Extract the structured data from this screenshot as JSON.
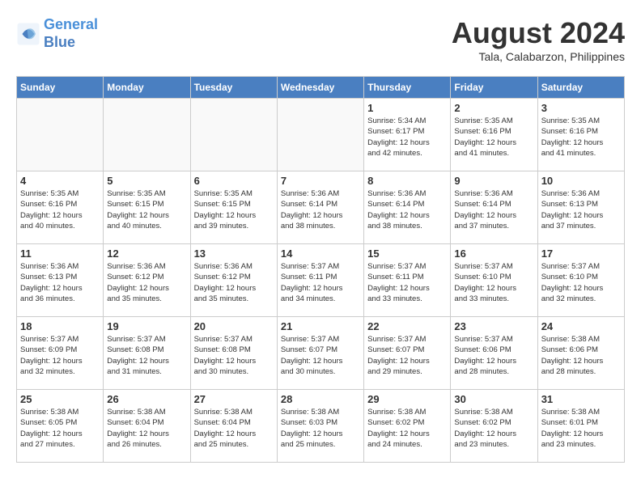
{
  "header": {
    "logo_line1": "General",
    "logo_line2": "Blue",
    "month": "August 2024",
    "location": "Tala, Calabarzon, Philippines"
  },
  "days_of_week": [
    "Sunday",
    "Monday",
    "Tuesday",
    "Wednesday",
    "Thursday",
    "Friday",
    "Saturday"
  ],
  "weeks": [
    [
      {
        "day": "",
        "info": ""
      },
      {
        "day": "",
        "info": ""
      },
      {
        "day": "",
        "info": ""
      },
      {
        "day": "",
        "info": ""
      },
      {
        "day": "1",
        "info": "Sunrise: 5:34 AM\nSunset: 6:17 PM\nDaylight: 12 hours\nand 42 minutes."
      },
      {
        "day": "2",
        "info": "Sunrise: 5:35 AM\nSunset: 6:16 PM\nDaylight: 12 hours\nand 41 minutes."
      },
      {
        "day": "3",
        "info": "Sunrise: 5:35 AM\nSunset: 6:16 PM\nDaylight: 12 hours\nand 41 minutes."
      }
    ],
    [
      {
        "day": "4",
        "info": "Sunrise: 5:35 AM\nSunset: 6:16 PM\nDaylight: 12 hours\nand 40 minutes."
      },
      {
        "day": "5",
        "info": "Sunrise: 5:35 AM\nSunset: 6:15 PM\nDaylight: 12 hours\nand 40 minutes."
      },
      {
        "day": "6",
        "info": "Sunrise: 5:35 AM\nSunset: 6:15 PM\nDaylight: 12 hours\nand 39 minutes."
      },
      {
        "day": "7",
        "info": "Sunrise: 5:36 AM\nSunset: 6:14 PM\nDaylight: 12 hours\nand 38 minutes."
      },
      {
        "day": "8",
        "info": "Sunrise: 5:36 AM\nSunset: 6:14 PM\nDaylight: 12 hours\nand 38 minutes."
      },
      {
        "day": "9",
        "info": "Sunrise: 5:36 AM\nSunset: 6:14 PM\nDaylight: 12 hours\nand 37 minutes."
      },
      {
        "day": "10",
        "info": "Sunrise: 5:36 AM\nSunset: 6:13 PM\nDaylight: 12 hours\nand 37 minutes."
      }
    ],
    [
      {
        "day": "11",
        "info": "Sunrise: 5:36 AM\nSunset: 6:13 PM\nDaylight: 12 hours\nand 36 minutes."
      },
      {
        "day": "12",
        "info": "Sunrise: 5:36 AM\nSunset: 6:12 PM\nDaylight: 12 hours\nand 35 minutes."
      },
      {
        "day": "13",
        "info": "Sunrise: 5:36 AM\nSunset: 6:12 PM\nDaylight: 12 hours\nand 35 minutes."
      },
      {
        "day": "14",
        "info": "Sunrise: 5:37 AM\nSunset: 6:11 PM\nDaylight: 12 hours\nand 34 minutes."
      },
      {
        "day": "15",
        "info": "Sunrise: 5:37 AM\nSunset: 6:11 PM\nDaylight: 12 hours\nand 33 minutes."
      },
      {
        "day": "16",
        "info": "Sunrise: 5:37 AM\nSunset: 6:10 PM\nDaylight: 12 hours\nand 33 minutes."
      },
      {
        "day": "17",
        "info": "Sunrise: 5:37 AM\nSunset: 6:10 PM\nDaylight: 12 hours\nand 32 minutes."
      }
    ],
    [
      {
        "day": "18",
        "info": "Sunrise: 5:37 AM\nSunset: 6:09 PM\nDaylight: 12 hours\nand 32 minutes."
      },
      {
        "day": "19",
        "info": "Sunrise: 5:37 AM\nSunset: 6:08 PM\nDaylight: 12 hours\nand 31 minutes."
      },
      {
        "day": "20",
        "info": "Sunrise: 5:37 AM\nSunset: 6:08 PM\nDaylight: 12 hours\nand 30 minutes."
      },
      {
        "day": "21",
        "info": "Sunrise: 5:37 AM\nSunset: 6:07 PM\nDaylight: 12 hours\nand 30 minutes."
      },
      {
        "day": "22",
        "info": "Sunrise: 5:37 AM\nSunset: 6:07 PM\nDaylight: 12 hours\nand 29 minutes."
      },
      {
        "day": "23",
        "info": "Sunrise: 5:37 AM\nSunset: 6:06 PM\nDaylight: 12 hours\nand 28 minutes."
      },
      {
        "day": "24",
        "info": "Sunrise: 5:38 AM\nSunset: 6:06 PM\nDaylight: 12 hours\nand 28 minutes."
      }
    ],
    [
      {
        "day": "25",
        "info": "Sunrise: 5:38 AM\nSunset: 6:05 PM\nDaylight: 12 hours\nand 27 minutes."
      },
      {
        "day": "26",
        "info": "Sunrise: 5:38 AM\nSunset: 6:04 PM\nDaylight: 12 hours\nand 26 minutes."
      },
      {
        "day": "27",
        "info": "Sunrise: 5:38 AM\nSunset: 6:04 PM\nDaylight: 12 hours\nand 25 minutes."
      },
      {
        "day": "28",
        "info": "Sunrise: 5:38 AM\nSunset: 6:03 PM\nDaylight: 12 hours\nand 25 minutes."
      },
      {
        "day": "29",
        "info": "Sunrise: 5:38 AM\nSunset: 6:02 PM\nDaylight: 12 hours\nand 24 minutes."
      },
      {
        "day": "30",
        "info": "Sunrise: 5:38 AM\nSunset: 6:02 PM\nDaylight: 12 hours\nand 23 minutes."
      },
      {
        "day": "31",
        "info": "Sunrise: 5:38 AM\nSunset: 6:01 PM\nDaylight: 12 hours\nand 23 minutes."
      }
    ]
  ]
}
